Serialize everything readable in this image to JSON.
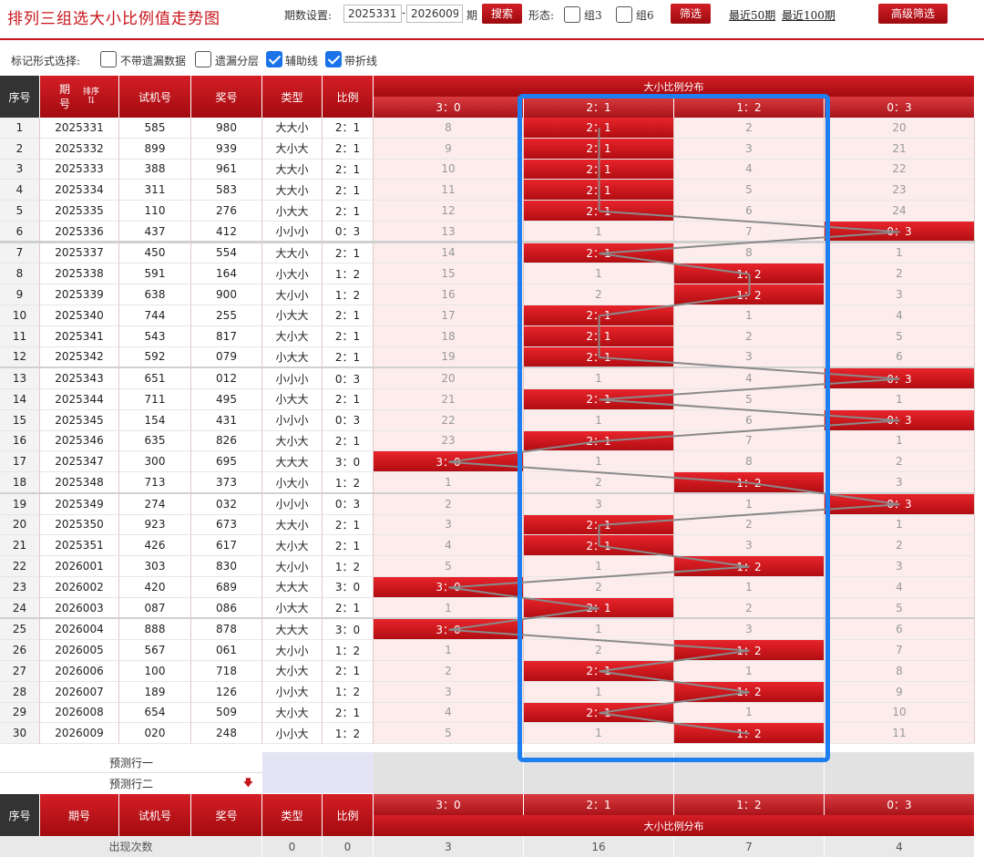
{
  "header": {
    "title": "排列三组选大小比例值走势图",
    "period_setting_label": "期数设置:",
    "period_from": "2025331",
    "dash": "-",
    "period_to": "2026009",
    "period_unit": "期",
    "search_label": "搜索",
    "form_label": "形态:",
    "group3_label": "组3",
    "group6_label": "组6",
    "filter_label": "筛选",
    "recent50_label": "最近50期",
    "recent100_label": "最近100期",
    "advanced_label": "高级筛选"
  },
  "options": {
    "label": "标记形式选择:",
    "no_missing_label": "不带遗漏数据",
    "missing_layer_label": "遗漏分层",
    "aux_line_label": "辅助线",
    "fold_line_label": "带折线",
    "no_missing_checked": false,
    "missing_layer_checked": false,
    "aux_line_checked": true,
    "fold_line_checked": true
  },
  "table": {
    "col_idx": "序号",
    "col_period": "期号",
    "col_period_top": "期",
    "col_period_bottom": "号",
    "col_sort": "排序",
    "col_trial": "试机号",
    "col_draw": "奖号",
    "col_type": "类型",
    "col_ratio": "比例",
    "col_dist": "大小比例分布",
    "dist_cols": [
      "3：0",
      "2：1",
      "1：2",
      "0：3"
    ],
    "rows": [
      {
        "idx": "1",
        "period": "2025331",
        "trial": "585",
        "draw": "980",
        "type": "大大小",
        "ratio": "2：1",
        "hit": 1,
        "miss": [
          "8",
          "",
          "2",
          "20"
        ]
      },
      {
        "idx": "2",
        "period": "2025332",
        "trial": "899",
        "draw": "939",
        "type": "大小大",
        "ratio": "2：1",
        "hit": 1,
        "miss": [
          "9",
          "",
          "3",
          "21"
        ]
      },
      {
        "idx": "3",
        "period": "2025333",
        "trial": "388",
        "draw": "961",
        "type": "大大小",
        "ratio": "2：1",
        "hit": 1,
        "miss": [
          "10",
          "",
          "4",
          "22"
        ]
      },
      {
        "idx": "4",
        "period": "2025334",
        "trial": "311",
        "draw": "583",
        "type": "大大小",
        "ratio": "2：1",
        "hit": 1,
        "miss": [
          "11",
          "",
          "5",
          "23"
        ]
      },
      {
        "idx": "5",
        "period": "2025335",
        "trial": "110",
        "draw": "276",
        "type": "小大大",
        "ratio": "2：1",
        "hit": 1,
        "miss": [
          "12",
          "",
          "6",
          "24"
        ]
      },
      {
        "idx": "6",
        "period": "2025336",
        "trial": "437",
        "draw": "412",
        "type": "小小小",
        "ratio": "0：3",
        "hit": 3,
        "miss": [
          "13",
          "1",
          "7",
          ""
        ]
      },
      {
        "idx": "7",
        "period": "2025337",
        "trial": "450",
        "draw": "554",
        "type": "大大小",
        "ratio": "2：1",
        "hit": 1,
        "miss": [
          "14",
          "",
          "8",
          "1"
        ]
      },
      {
        "idx": "8",
        "period": "2025338",
        "trial": "591",
        "draw": "164",
        "type": "小大小",
        "ratio": "1：2",
        "hit": 2,
        "miss": [
          "15",
          "1",
          "",
          "2"
        ]
      },
      {
        "idx": "9",
        "period": "2025339",
        "trial": "638",
        "draw": "900",
        "type": "大小小",
        "ratio": "1：2",
        "hit": 2,
        "miss": [
          "16",
          "2",
          "",
          "3"
        ]
      },
      {
        "idx": "10",
        "period": "2025340",
        "trial": "744",
        "draw": "255",
        "type": "小大大",
        "ratio": "2：1",
        "hit": 1,
        "miss": [
          "17",
          "",
          "1",
          "4"
        ]
      },
      {
        "idx": "11",
        "period": "2025341",
        "trial": "543",
        "draw": "817",
        "type": "大小大",
        "ratio": "2：1",
        "hit": 1,
        "miss": [
          "18",
          "",
          "2",
          "5"
        ]
      },
      {
        "idx": "12",
        "period": "2025342",
        "trial": "592",
        "draw": "079",
        "type": "小大大",
        "ratio": "2：1",
        "hit": 1,
        "miss": [
          "19",
          "",
          "3",
          "6"
        ]
      },
      {
        "idx": "13",
        "period": "2025343",
        "trial": "651",
        "draw": "012",
        "type": "小小小",
        "ratio": "0：3",
        "hit": 3,
        "miss": [
          "20",
          "1",
          "4",
          ""
        ]
      },
      {
        "idx": "14",
        "period": "2025344",
        "trial": "711",
        "draw": "495",
        "type": "小大大",
        "ratio": "2：1",
        "hit": 1,
        "miss": [
          "21",
          "",
          "5",
          "1"
        ]
      },
      {
        "idx": "15",
        "period": "2025345",
        "trial": "154",
        "draw": "431",
        "type": "小小小",
        "ratio": "0：3",
        "hit": 3,
        "miss": [
          "22",
          "1",
          "6",
          ""
        ]
      },
      {
        "idx": "16",
        "period": "2025346",
        "trial": "635",
        "draw": "826",
        "type": "大小大",
        "ratio": "2：1",
        "hit": 1,
        "miss": [
          "23",
          "",
          "7",
          "1"
        ]
      },
      {
        "idx": "17",
        "period": "2025347",
        "trial": "300",
        "draw": "695",
        "type": "大大大",
        "ratio": "3：0",
        "hit": 0,
        "miss": [
          "",
          "1",
          "8",
          "2"
        ]
      },
      {
        "idx": "18",
        "period": "2025348",
        "trial": "713",
        "draw": "373",
        "type": "小大小",
        "ratio": "1：2",
        "hit": 2,
        "miss": [
          "1",
          "2",
          "",
          "3"
        ]
      },
      {
        "idx": "19",
        "period": "2025349",
        "trial": "274",
        "draw": "032",
        "type": "小小小",
        "ratio": "0：3",
        "hit": 3,
        "miss": [
          "2",
          "3",
          "1",
          ""
        ]
      },
      {
        "idx": "20",
        "period": "2025350",
        "trial": "923",
        "draw": "673",
        "type": "大大小",
        "ratio": "2：1",
        "hit": 1,
        "miss": [
          "3",
          "",
          "2",
          "1"
        ]
      },
      {
        "idx": "21",
        "period": "2025351",
        "trial": "426",
        "draw": "617",
        "type": "大小大",
        "ratio": "2：1",
        "hit": 1,
        "miss": [
          "4",
          "",
          "3",
          "2"
        ]
      },
      {
        "idx": "22",
        "period": "2026001",
        "trial": "303",
        "draw": "830",
        "type": "大小小",
        "ratio": "1：2",
        "hit": 2,
        "miss": [
          "5",
          "1",
          "",
          "3"
        ]
      },
      {
        "idx": "23",
        "period": "2026002",
        "trial": "420",
        "draw": "689",
        "type": "大大大",
        "ratio": "3：0",
        "hit": 0,
        "miss": [
          "",
          "2",
          "1",
          "4"
        ]
      },
      {
        "idx": "24",
        "period": "2026003",
        "trial": "087",
        "draw": "086",
        "type": "小大大",
        "ratio": "2：1",
        "hit": 1,
        "miss": [
          "1",
          "",
          "2",
          "5"
        ]
      },
      {
        "idx": "25",
        "period": "2026004",
        "trial": "888",
        "draw": "878",
        "type": "大大大",
        "ratio": "3：0",
        "hit": 0,
        "miss": [
          "",
          "1",
          "3",
          "6"
        ]
      },
      {
        "idx": "26",
        "period": "2026005",
        "trial": "567",
        "draw": "061",
        "type": "大小小",
        "ratio": "1：2",
        "hit": 2,
        "miss": [
          "1",
          "2",
          "",
          "7"
        ]
      },
      {
        "idx": "27",
        "period": "2026006",
        "trial": "100",
        "draw": "718",
        "type": "大小大",
        "ratio": "2：1",
        "hit": 1,
        "miss": [
          "2",
          "",
          "1",
          "8"
        ]
      },
      {
        "idx": "28",
        "period": "2026007",
        "trial": "189",
        "draw": "126",
        "type": "小小大",
        "ratio": "1：2",
        "hit": 2,
        "miss": [
          "3",
          "1",
          "",
          "9"
        ]
      },
      {
        "idx": "29",
        "period": "2026008",
        "trial": "654",
        "draw": "509",
        "type": "大小大",
        "ratio": "2：1",
        "hit": 1,
        "miss": [
          "4",
          "",
          "1",
          "10"
        ]
      },
      {
        "idx": "30",
        "period": "2026009",
        "trial": "020",
        "draw": "248",
        "type": "小小大",
        "ratio": "1：2",
        "hit": 2,
        "miss": [
          "5",
          "1",
          "",
          "11"
        ]
      }
    ],
    "predict1_label": "预测行一",
    "predict2_label": "预测行二",
    "footer_count_label": "出现次数",
    "footer_type_count": "0",
    "footer_ratio_count": "0",
    "footer_counts": [
      "3",
      "16",
      "7",
      "4"
    ]
  },
  "colors": {
    "brand_red": "#c8141b",
    "highlight_blue": "#1e7ff0",
    "miss_bg": "#fdecec"
  }
}
